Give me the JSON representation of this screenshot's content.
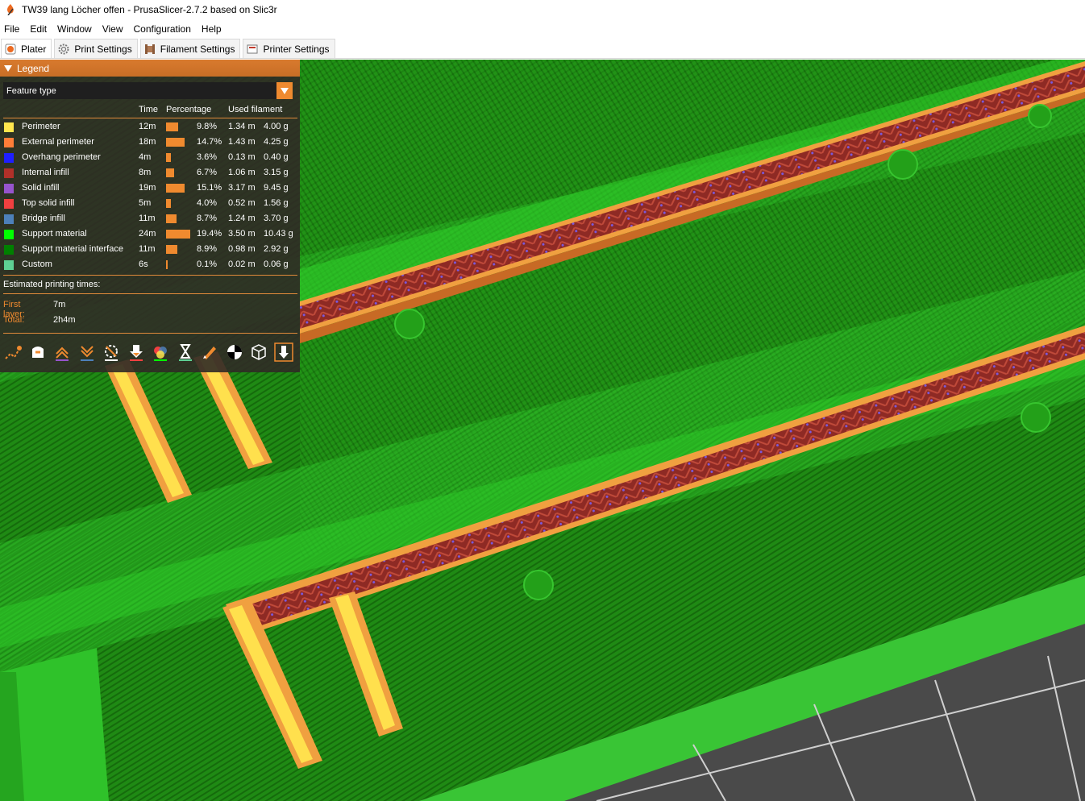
{
  "window": {
    "title": "TW39 lang Löcher offen - PrusaSlicer-2.7.2 based on Slic3r"
  },
  "menu": [
    "File",
    "Edit",
    "Window",
    "View",
    "Configuration",
    "Help"
  ],
  "tabs": [
    {
      "label": "Plater",
      "icon": "plater-icon"
    },
    {
      "label": "Print Settings",
      "icon": "gear-icon"
    },
    {
      "label": "Filament Settings",
      "icon": "spool-icon"
    },
    {
      "label": "Printer Settings",
      "icon": "printer-icon"
    }
  ],
  "legend": {
    "header": "Legend",
    "view_type": "Feature type",
    "columns": {
      "time": "Time",
      "percentage": "Percentage",
      "used_filament": "Used filament"
    },
    "rows": [
      {
        "name": "Perimeter",
        "color": "#FFE64D",
        "time": "12m",
        "percent": "9.8%",
        "pct_value": 9.8,
        "length": "1.34 m",
        "weight": "4.00 g"
      },
      {
        "name": "External perimeter",
        "color": "#FF7D38",
        "time": "18m",
        "percent": "14.7%",
        "pct_value": 14.7,
        "length": "1.43 m",
        "weight": "4.25 g"
      },
      {
        "name": "Overhang perimeter",
        "color": "#1F1FFF",
        "time": "4m",
        "percent": "3.6%",
        "pct_value": 3.6,
        "length": "0.13 m",
        "weight": "0.40 g"
      },
      {
        "name": "Internal infill",
        "color": "#B03029",
        "time": "8m",
        "percent": "6.7%",
        "pct_value": 6.7,
        "length": "1.06 m",
        "weight": "3.15 g"
      },
      {
        "name": "Solid infill",
        "color": "#9654CC",
        "time": "19m",
        "percent": "15.1%",
        "pct_value": 15.1,
        "length": "3.17 m",
        "weight": "9.45 g"
      },
      {
        "name": "Top solid infill",
        "color": "#F04040",
        "time": "5m",
        "percent": "4.0%",
        "pct_value": 4.0,
        "length": "0.52 m",
        "weight": "1.56 g"
      },
      {
        "name": "Bridge infill",
        "color": "#4D80BA",
        "time": "11m",
        "percent": "8.7%",
        "pct_value": 8.7,
        "length": "1.24 m",
        "weight": "3.70 g"
      },
      {
        "name": "Support material",
        "color": "#00FF00",
        "time": "24m",
        "percent": "19.4%",
        "pct_value": 19.4,
        "length": "3.50 m",
        "weight": "10.43 g"
      },
      {
        "name": "Support material interface",
        "color": "#008000",
        "time": "11m",
        "percent": "8.9%",
        "pct_value": 8.9,
        "length": "0.98 m",
        "weight": "2.92 g"
      },
      {
        "name": "Custom",
        "color": "#5ED194",
        "time": "6s",
        "percent": "0.1%",
        "pct_value": 0.1,
        "length": "0.02 m",
        "weight": "0.06 g"
      }
    ],
    "estimated_title": "Estimated printing times:",
    "first_layer_label": "First layer:",
    "first_layer_value": "7m",
    "total_label": "Total:",
    "total_value": "2h4m"
  },
  "toolbar_icons": [
    "travel-icon",
    "wipe-icon",
    "retractions-icon",
    "deretractions-icon",
    "seams-icon",
    "tool-changes-icon",
    "color-changes-icon",
    "pause-prints-icon",
    "custom-gcode-icon",
    "center-of-gravity-icon",
    "shells-icon",
    "tool-marker-icon"
  ]
}
